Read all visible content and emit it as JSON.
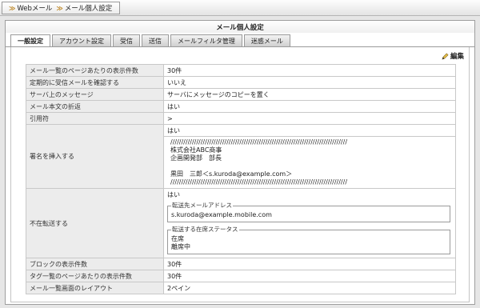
{
  "breadcrumb": {
    "items": [
      "Webメール",
      "メール個人設定"
    ]
  },
  "panel": {
    "title": "メール個人設定"
  },
  "tabs": [
    {
      "label": "一般設定",
      "active": true
    },
    {
      "label": "アカウント設定",
      "active": false
    },
    {
      "label": "受信",
      "active": false
    },
    {
      "label": "送信",
      "active": false
    },
    {
      "label": "メールフィルタ管理",
      "active": false
    },
    {
      "label": "迷惑メール",
      "active": false
    }
  ],
  "edit": {
    "label": "編集",
    "icon": "pencil-icon"
  },
  "settings": {
    "rows": [
      {
        "label": "メール一覧のページあたりの表示件数",
        "value": "30件"
      },
      {
        "label": "定期的に受信メールを確認する",
        "value": "いいえ"
      },
      {
        "label": "サーバ上のメッセージ",
        "value": "サーバにメッセージのコピーを置く"
      },
      {
        "label": "メール本文の折返",
        "value": "はい"
      },
      {
        "label": "引用符",
        "value": ">"
      }
    ],
    "signature": {
      "label": "署名を挿入する",
      "value": "はい",
      "lines": [
        "//////////////////////////////////////////////////////////////////////////////////",
        "株式会社ABC商事",
        "企画開発部　部長",
        "",
        "黒田　三郎＜s.kuroda@example.com＞",
        "//////////////////////////////////////////////////////////////////////////////////"
      ]
    },
    "absence": {
      "label": "不在転送する",
      "value": "はい",
      "forward_legend": "転送先メールアドレス",
      "forward_address": "s.kuroda@example.mobile.com",
      "status_legend": "転送する在席ステータス",
      "statuses": [
        "在席",
        "離席中"
      ]
    },
    "rows_after": [
      {
        "label": "ブロックの表示件数",
        "value": "30件"
      },
      {
        "label": "タグ一覧のページあたりの表示件数",
        "value": "30件"
      },
      {
        "label": "メール一覧画面のレイアウト",
        "value": "2ペイン"
      }
    ]
  },
  "colors": {
    "label_bg": "#ececec",
    "border": "#c8c8c8",
    "breadcrumb_arrow": "#c08a2a"
  }
}
